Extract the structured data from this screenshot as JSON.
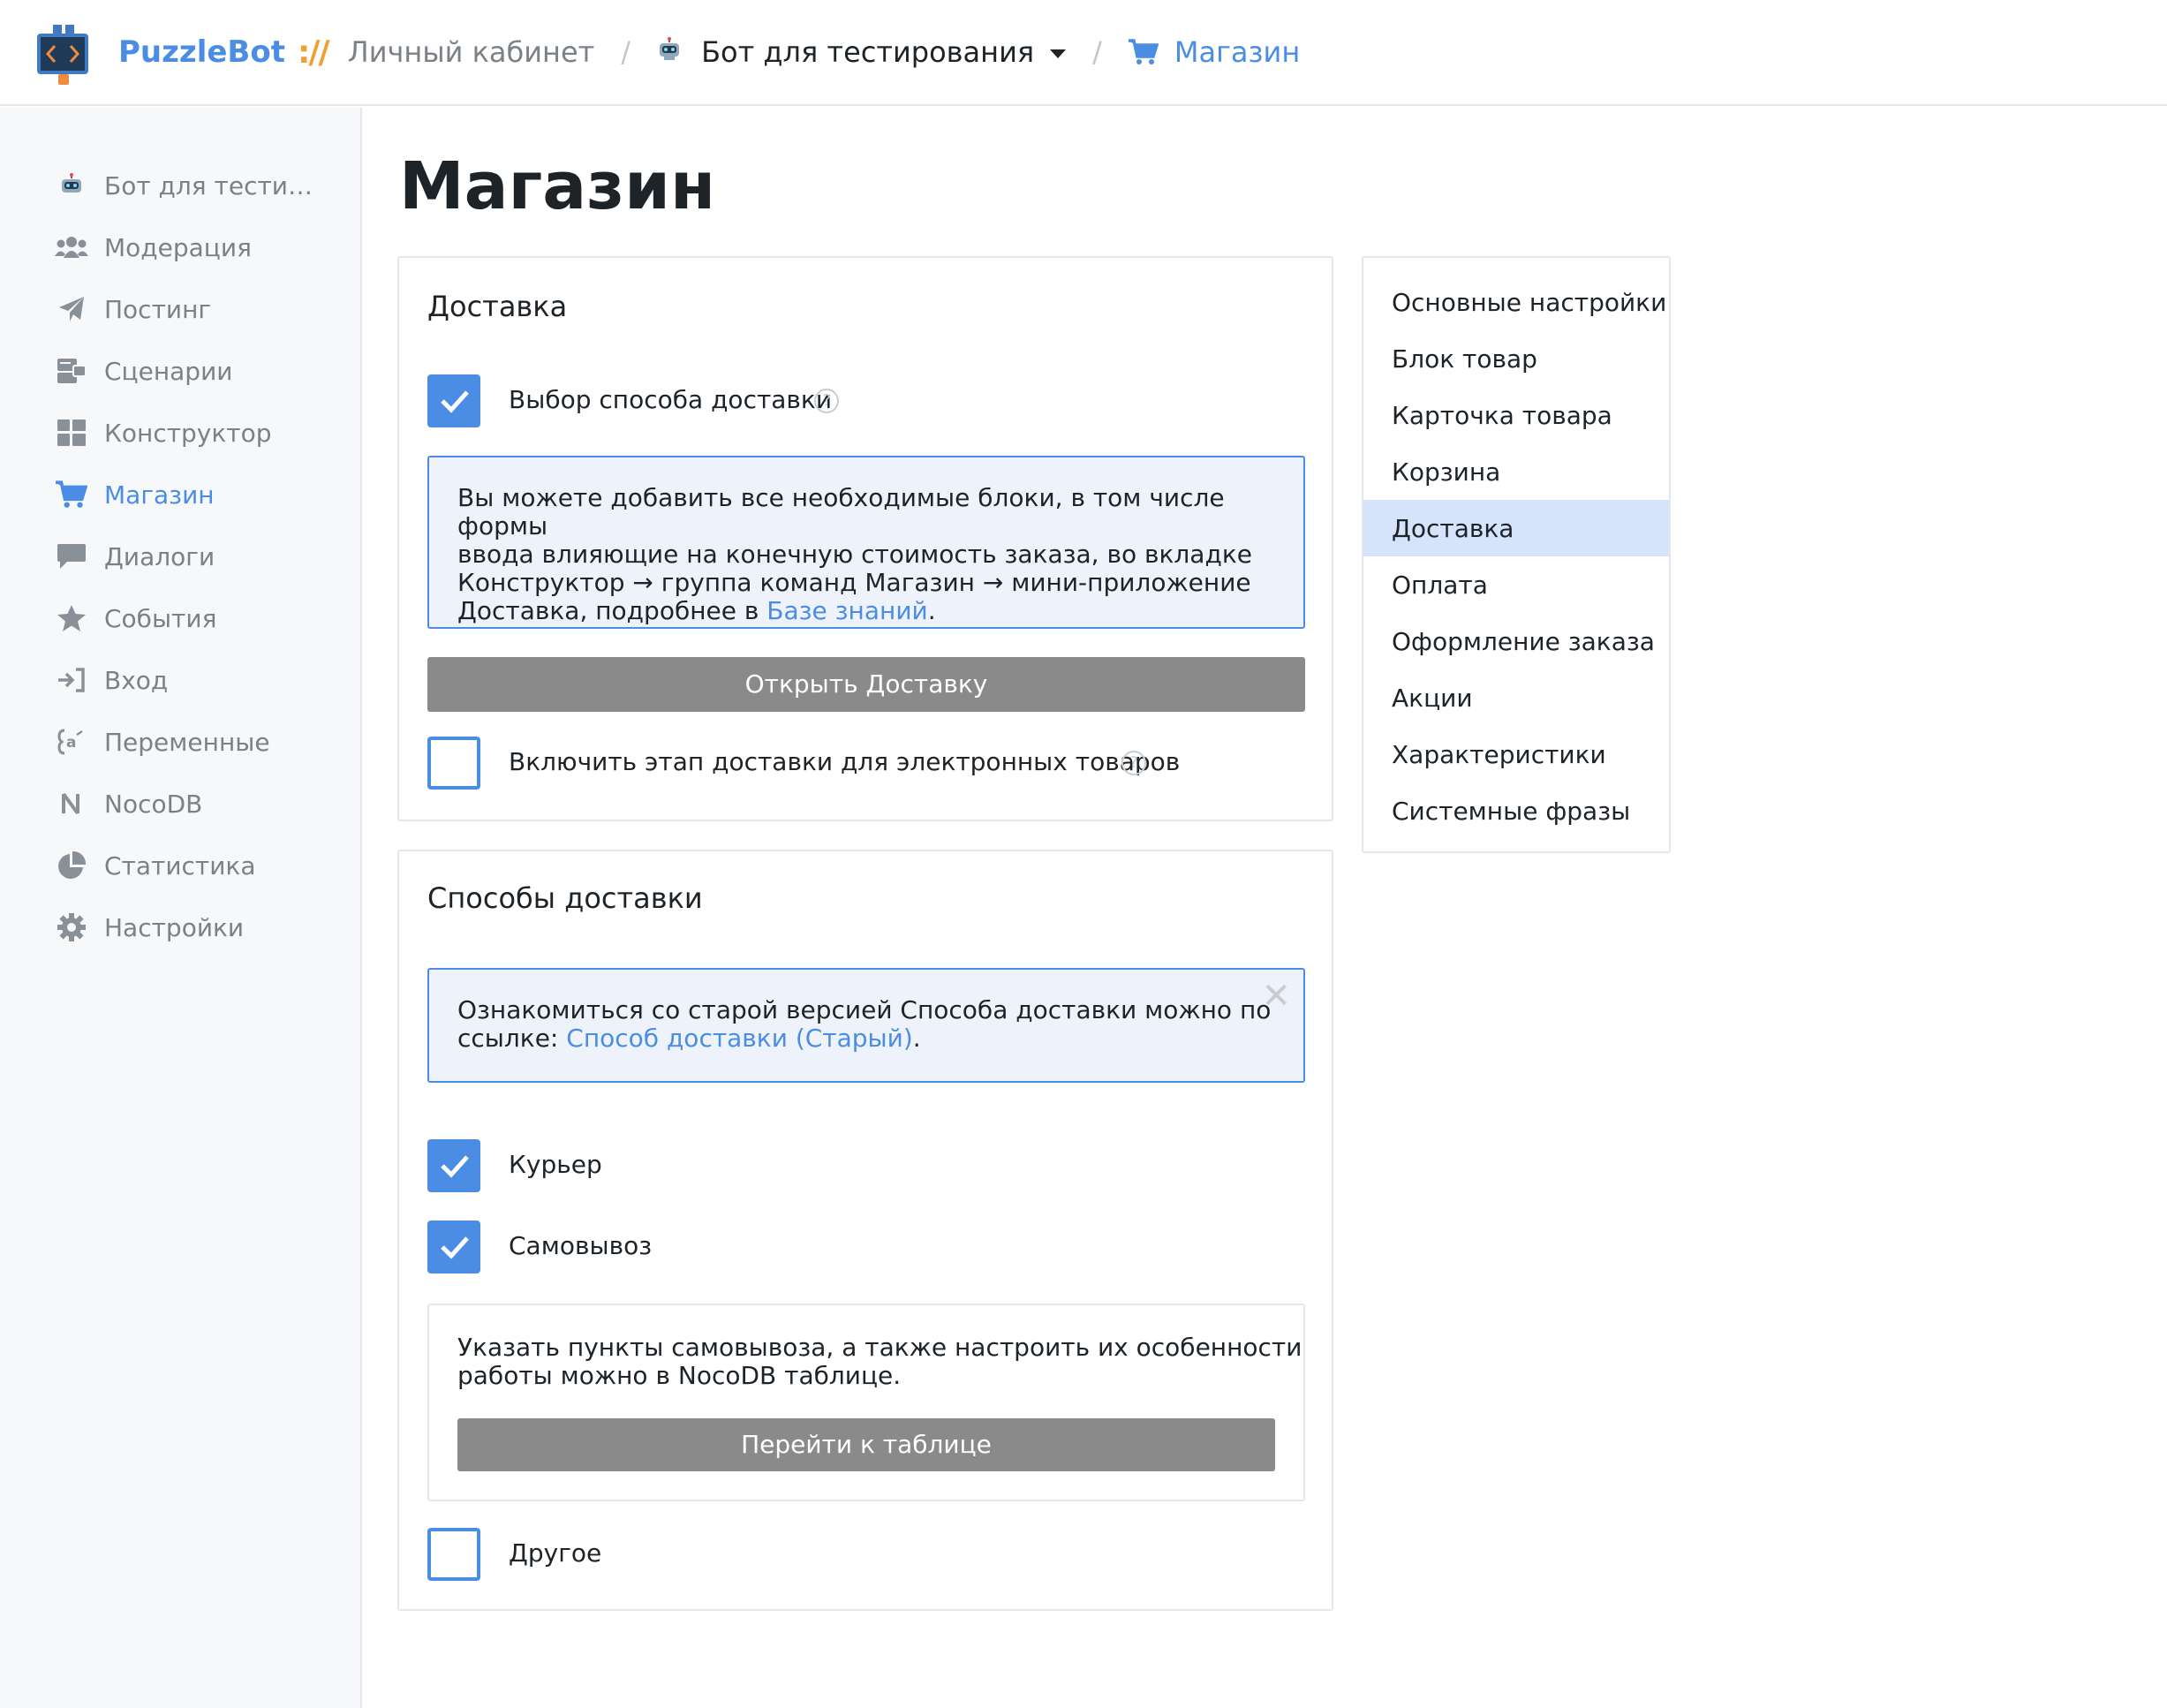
{
  "header": {
    "brand": "PuzzleBot",
    "slashes": "://",
    "cabinet": "Личный кабинет",
    "bot_name": "Бот для тестирования",
    "current": "Магазин"
  },
  "sidebar": {
    "items": [
      {
        "label": "Бот для тести…",
        "icon": "robot-icon"
      },
      {
        "label": "Модерация",
        "icon": "users-icon"
      },
      {
        "label": "Постинг",
        "icon": "paper-plane-icon"
      },
      {
        "label": "Сценарии",
        "icon": "scenarios-icon"
      },
      {
        "label": "Конструктор",
        "icon": "grid-icon"
      },
      {
        "label": "Магазин",
        "icon": "cart-icon"
      },
      {
        "label": "Диалоги",
        "icon": "chat-icon"
      },
      {
        "label": "События",
        "icon": "star-icon"
      },
      {
        "label": "Вход",
        "icon": "sign-in-icon"
      },
      {
        "label": "Переменные",
        "icon": "variable-icon"
      },
      {
        "label": "NocoDB",
        "icon": "nocodb-icon"
      },
      {
        "label": "Статистика",
        "icon": "pie-chart-icon"
      },
      {
        "label": "Настройки",
        "icon": "gear-icon"
      }
    ],
    "active": "Магазин"
  },
  "main": {
    "title": "Магазин",
    "delivery": {
      "title": "Доставка",
      "choose_method": {
        "label": "Выбор способа доставки",
        "checked": true
      },
      "info_text_1": "Вы можете добавить все необходимые блоки, в том числе формы",
      "info_text_2": "ввода влияющие на конечную стоимость заказа, во вкладке",
      "info_text_3": "Конструктор → группа команд Магазин → мини-приложение",
      "info_text_4": "Доставка, подробнее в ",
      "info_link": "Базе знаний",
      "info_tail": ".",
      "open_button": "Открыть Доставку",
      "digital_stage": {
        "label": "Включить этап доставки для электронных товаров",
        "checked": false
      }
    },
    "methods": {
      "title": "Способы доставки",
      "notice_1": "Ознакомиться со старой версией Способа доставки можно по",
      "notice_2": "ссылке: ",
      "notice_link": "Способ доставки (Старый)",
      "notice_tail": ".",
      "close_glyph": "✕",
      "courier": {
        "label": "Курьер",
        "checked": true
      },
      "pickup": {
        "label": "Самовывоз",
        "checked": true
      },
      "pickup_text_1": "Указать пункты самовывоза, а также настроить их особенности",
      "pickup_text_2": "работы можно в NocoDB таблице.",
      "table_button": "Перейти к таблице",
      "other": {
        "label": "Другое",
        "checked": false
      }
    }
  },
  "right_nav": {
    "items": [
      "Основные настройки",
      "Блок товар",
      "Карточка товара",
      "Корзина",
      "Доставка",
      "Оплата",
      "Оформление заказа",
      "Акции",
      "Характеристики",
      "Системные фразы"
    ],
    "active": "Доставка"
  },
  "colors": {
    "accent": "#4b8de4",
    "button_gray": "#8a8a8a",
    "info_bg": "#eef2fb",
    "active_nav_bg": "#d5e3fb",
    "brand_slashes": "#f0a030"
  }
}
